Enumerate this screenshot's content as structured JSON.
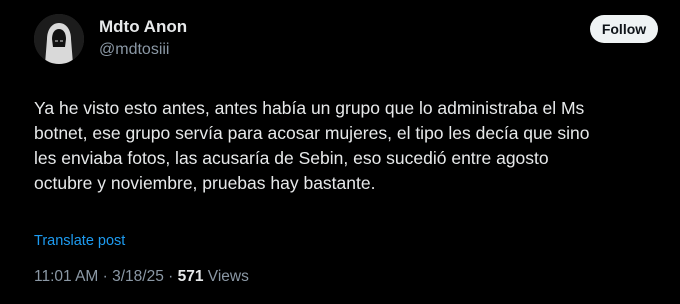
{
  "author": {
    "display_name": "Mdto Anon",
    "handle": "@mdtosiii",
    "avatar_icon": "hooded-figure-avatar"
  },
  "follow_button": {
    "label": "Follow"
  },
  "tweet": {
    "lines": [
      "Ya he visto esto antes, antes había un grupo que lo administraba el Ms",
      "botnet, ese grupo servía para acosar mujeres, el tipo les decía que sino",
      "les enviaba fotos, las acusaría de Sebin, eso sucedió entre agosto",
      "octubre y noviembre, pruebas hay bastante."
    ],
    "translate_label": "Translate post"
  },
  "meta": {
    "time": "11:01 AM",
    "sep1": " · ",
    "date": "3/18/25",
    "sep2": " · ",
    "views_count": "571",
    "views_label": " Views"
  },
  "colors": {
    "background": "#000000",
    "text": "#e7e9ea",
    "secondary": "#8b98a5",
    "link": "#1d9bf0",
    "button_bg": "#eff3f4"
  }
}
